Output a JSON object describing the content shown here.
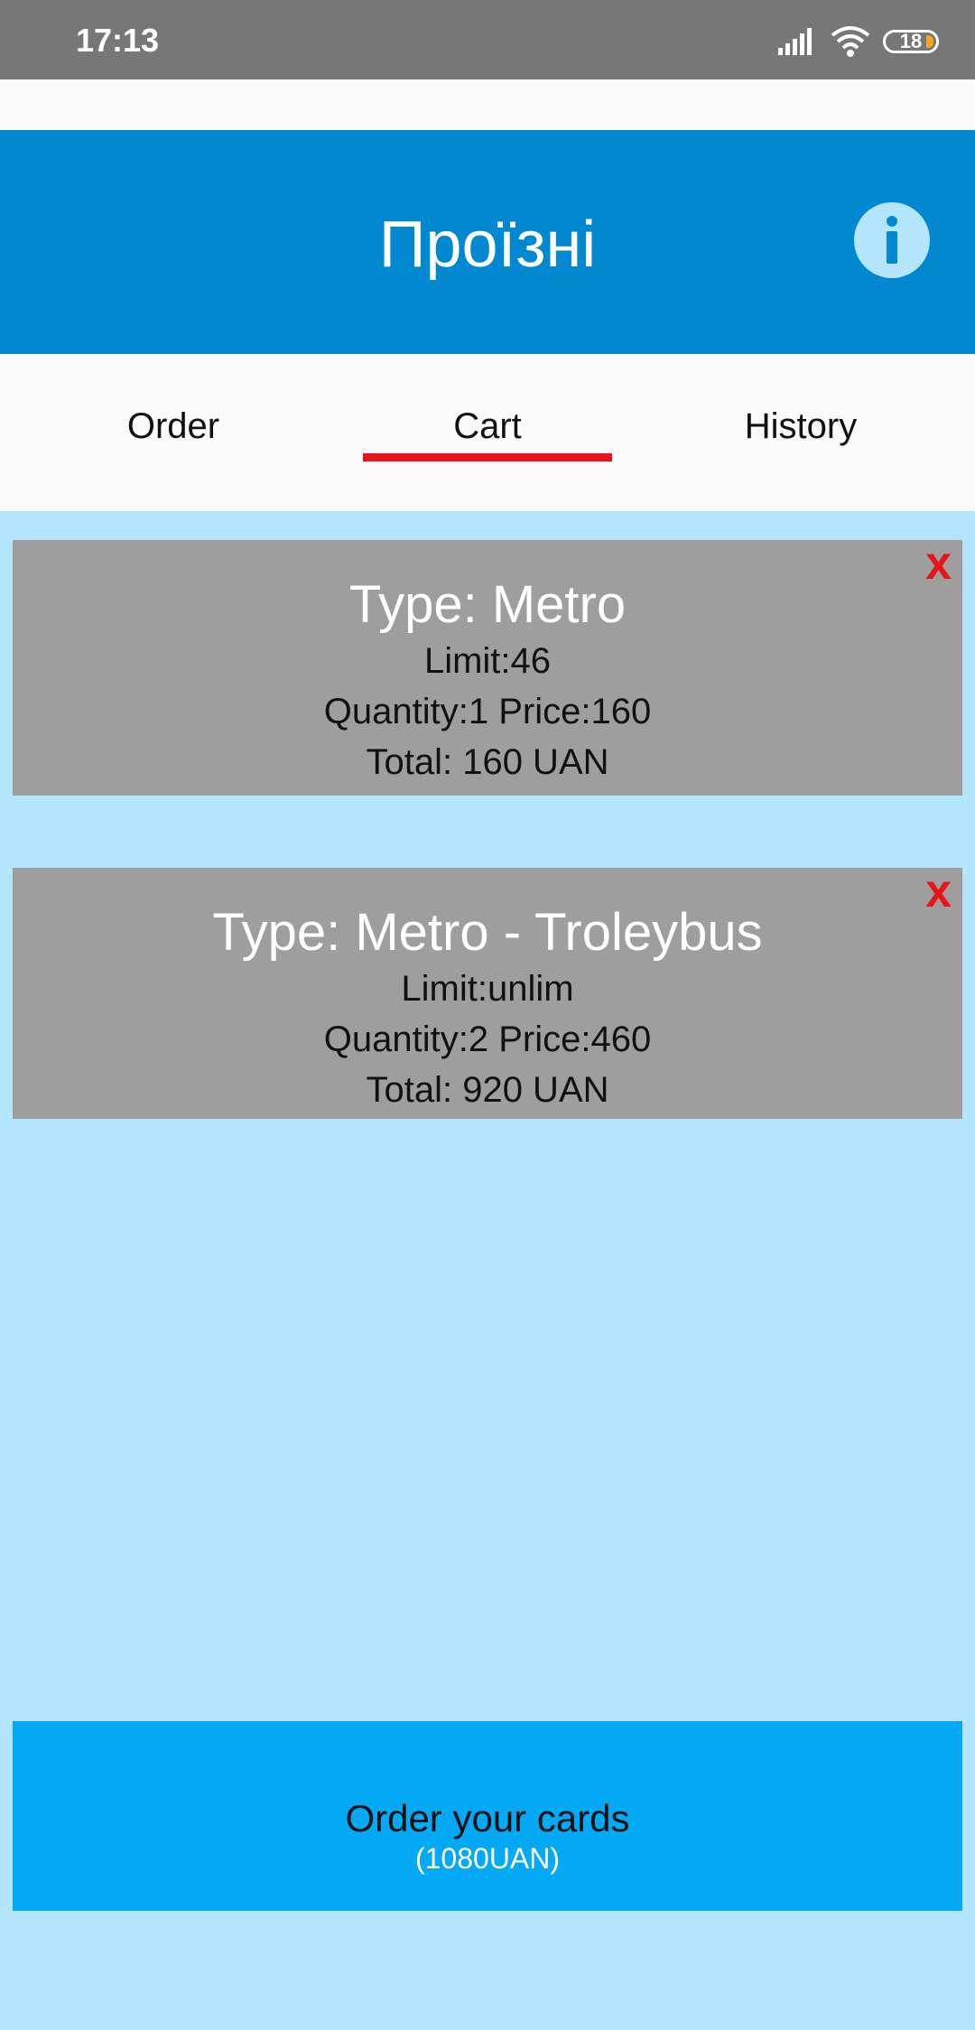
{
  "status_bar": {
    "time": "17:13",
    "battery_level": "18",
    "icons": [
      "signal-icon",
      "wifi-icon",
      "battery-icon"
    ]
  },
  "app_bar": {
    "title": "Проїзні",
    "info_icon": "info-icon"
  },
  "tabs": [
    {
      "label": "Order",
      "selected": false
    },
    {
      "label": "Cart",
      "selected": true
    },
    {
      "label": "History",
      "selected": false
    }
  ],
  "cart_items": [
    {
      "type": "Type: Metro",
      "limit": "Limit:46",
      "quantity_price": "Quantity:1 Price:160",
      "total": "Total: 160 UAN",
      "remove": "x"
    },
    {
      "type": "Type: Metro - Troleybus",
      "limit": "Limit:unlim",
      "quantity_price": "Quantity:2 Price:460",
      "total": "Total: 920 UAN",
      "remove": "x"
    }
  ],
  "order_button": {
    "label": "Order your cards",
    "total": "(1080UAN)"
  },
  "colors": {
    "app_bar": "#0288d1",
    "background": "#b3e5fc",
    "card": "#9e9e9e",
    "accent_red": "#e8131b",
    "button": "#03a9f4"
  }
}
